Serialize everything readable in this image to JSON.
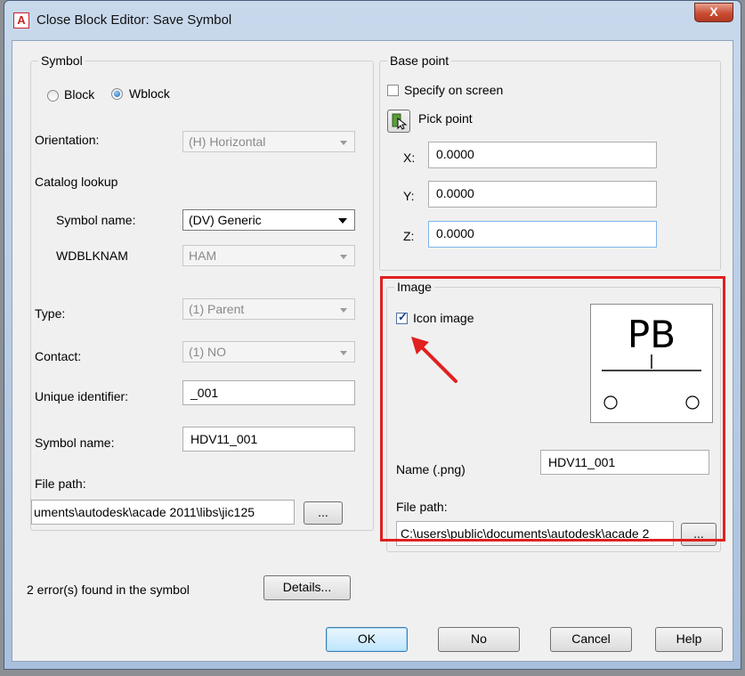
{
  "window": {
    "title": "Close Block Editor: Save Symbol",
    "close_label": "X",
    "app_icon_letter": "A"
  },
  "symbol": {
    "group_title": "Symbol",
    "radio_block_label": "Block",
    "radio_wblock_label": "Wblock",
    "orientation_label": "Orientation:",
    "orientation_value": "(H) Horizontal",
    "catalog_lookup_label": "Catalog lookup",
    "symbol_name_label": "Symbol name:",
    "symbol_name_value": "(DV) Generic",
    "wdblknam_label": "WDBLKNAM",
    "wdblknam_value": "HAM",
    "type_label": "Type:",
    "type_value": "(1) Parent",
    "contact_label": "Contact:",
    "contact_value": "(1) NO",
    "unique_id_label": "Unique identifier:",
    "unique_id_value": "_001",
    "symbol_name2_label": "Symbol name:",
    "symbol_name2_value": "HDV11_001",
    "file_path_label": "File path:",
    "file_path_value": "uments\\autodesk\\acade 2011\\libs\\jic125",
    "browse_label": "..."
  },
  "base_point": {
    "group_title": "Base point",
    "specify_on_screen_label": "Specify on screen",
    "pick_point_label": "Pick point",
    "x_label": "X:",
    "x_value": "0.0000",
    "y_label": "Y:",
    "y_value": "0.0000",
    "z_label": "Z:",
    "z_value": "0.0000"
  },
  "image": {
    "group_title": "Image",
    "icon_image_label": "Icon image",
    "icon_image_checked": true,
    "preview_text": "PB",
    "name_label": "Name (.png)",
    "name_value": "HDV11_001",
    "file_path_label": "File path:",
    "file_path_value": "C:\\users\\public\\documents\\autodesk\\acade 2",
    "browse_label": "..."
  },
  "footer": {
    "errors_text": "2 error(s) found in the symbol",
    "details_label": "Details...",
    "ok_label": "OK",
    "no_label": "No",
    "cancel_label": "Cancel",
    "help_label": "Help"
  },
  "colors": {
    "highlight": "#e02020",
    "arrow": "#e02020"
  }
}
